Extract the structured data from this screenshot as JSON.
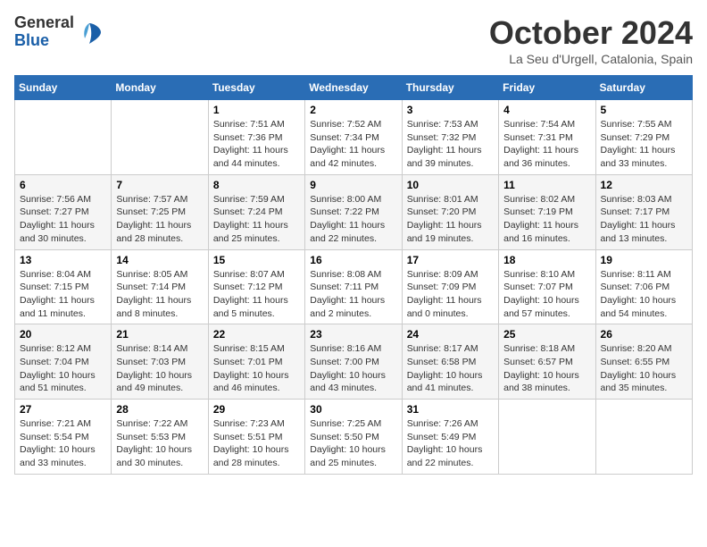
{
  "header": {
    "logo_general": "General",
    "logo_blue": "Blue",
    "month": "October 2024",
    "location": "La Seu d'Urgell, Catalonia, Spain"
  },
  "weekdays": [
    "Sunday",
    "Monday",
    "Tuesday",
    "Wednesday",
    "Thursday",
    "Friday",
    "Saturday"
  ],
  "weeks": [
    [
      {
        "day": "",
        "sunrise": "",
        "sunset": "",
        "daylight": ""
      },
      {
        "day": "",
        "sunrise": "",
        "sunset": "",
        "daylight": ""
      },
      {
        "day": "1",
        "sunrise": "Sunrise: 7:51 AM",
        "sunset": "Sunset: 7:36 PM",
        "daylight": "Daylight: 11 hours and 44 minutes."
      },
      {
        "day": "2",
        "sunrise": "Sunrise: 7:52 AM",
        "sunset": "Sunset: 7:34 PM",
        "daylight": "Daylight: 11 hours and 42 minutes."
      },
      {
        "day": "3",
        "sunrise": "Sunrise: 7:53 AM",
        "sunset": "Sunset: 7:32 PM",
        "daylight": "Daylight: 11 hours and 39 minutes."
      },
      {
        "day": "4",
        "sunrise": "Sunrise: 7:54 AM",
        "sunset": "Sunset: 7:31 PM",
        "daylight": "Daylight: 11 hours and 36 minutes."
      },
      {
        "day": "5",
        "sunrise": "Sunrise: 7:55 AM",
        "sunset": "Sunset: 7:29 PM",
        "daylight": "Daylight: 11 hours and 33 minutes."
      }
    ],
    [
      {
        "day": "6",
        "sunrise": "Sunrise: 7:56 AM",
        "sunset": "Sunset: 7:27 PM",
        "daylight": "Daylight: 11 hours and 30 minutes."
      },
      {
        "day": "7",
        "sunrise": "Sunrise: 7:57 AM",
        "sunset": "Sunset: 7:25 PM",
        "daylight": "Daylight: 11 hours and 28 minutes."
      },
      {
        "day": "8",
        "sunrise": "Sunrise: 7:59 AM",
        "sunset": "Sunset: 7:24 PM",
        "daylight": "Daylight: 11 hours and 25 minutes."
      },
      {
        "day": "9",
        "sunrise": "Sunrise: 8:00 AM",
        "sunset": "Sunset: 7:22 PM",
        "daylight": "Daylight: 11 hours and 22 minutes."
      },
      {
        "day": "10",
        "sunrise": "Sunrise: 8:01 AM",
        "sunset": "Sunset: 7:20 PM",
        "daylight": "Daylight: 11 hours and 19 minutes."
      },
      {
        "day": "11",
        "sunrise": "Sunrise: 8:02 AM",
        "sunset": "Sunset: 7:19 PM",
        "daylight": "Daylight: 11 hours and 16 minutes."
      },
      {
        "day": "12",
        "sunrise": "Sunrise: 8:03 AM",
        "sunset": "Sunset: 7:17 PM",
        "daylight": "Daylight: 11 hours and 13 minutes."
      }
    ],
    [
      {
        "day": "13",
        "sunrise": "Sunrise: 8:04 AM",
        "sunset": "Sunset: 7:15 PM",
        "daylight": "Daylight: 11 hours and 11 minutes."
      },
      {
        "day": "14",
        "sunrise": "Sunrise: 8:05 AM",
        "sunset": "Sunset: 7:14 PM",
        "daylight": "Daylight: 11 hours and 8 minutes."
      },
      {
        "day": "15",
        "sunrise": "Sunrise: 8:07 AM",
        "sunset": "Sunset: 7:12 PM",
        "daylight": "Daylight: 11 hours and 5 minutes."
      },
      {
        "day": "16",
        "sunrise": "Sunrise: 8:08 AM",
        "sunset": "Sunset: 7:11 PM",
        "daylight": "Daylight: 11 hours and 2 minutes."
      },
      {
        "day": "17",
        "sunrise": "Sunrise: 8:09 AM",
        "sunset": "Sunset: 7:09 PM",
        "daylight": "Daylight: 11 hours and 0 minutes."
      },
      {
        "day": "18",
        "sunrise": "Sunrise: 8:10 AM",
        "sunset": "Sunset: 7:07 PM",
        "daylight": "Daylight: 10 hours and 57 minutes."
      },
      {
        "day": "19",
        "sunrise": "Sunrise: 8:11 AM",
        "sunset": "Sunset: 7:06 PM",
        "daylight": "Daylight: 10 hours and 54 minutes."
      }
    ],
    [
      {
        "day": "20",
        "sunrise": "Sunrise: 8:12 AM",
        "sunset": "Sunset: 7:04 PM",
        "daylight": "Daylight: 10 hours and 51 minutes."
      },
      {
        "day": "21",
        "sunrise": "Sunrise: 8:14 AM",
        "sunset": "Sunset: 7:03 PM",
        "daylight": "Daylight: 10 hours and 49 minutes."
      },
      {
        "day": "22",
        "sunrise": "Sunrise: 8:15 AM",
        "sunset": "Sunset: 7:01 PM",
        "daylight": "Daylight: 10 hours and 46 minutes."
      },
      {
        "day": "23",
        "sunrise": "Sunrise: 8:16 AM",
        "sunset": "Sunset: 7:00 PM",
        "daylight": "Daylight: 10 hours and 43 minutes."
      },
      {
        "day": "24",
        "sunrise": "Sunrise: 8:17 AM",
        "sunset": "Sunset: 6:58 PM",
        "daylight": "Daylight: 10 hours and 41 minutes."
      },
      {
        "day": "25",
        "sunrise": "Sunrise: 8:18 AM",
        "sunset": "Sunset: 6:57 PM",
        "daylight": "Daylight: 10 hours and 38 minutes."
      },
      {
        "day": "26",
        "sunrise": "Sunrise: 8:20 AM",
        "sunset": "Sunset: 6:55 PM",
        "daylight": "Daylight: 10 hours and 35 minutes."
      }
    ],
    [
      {
        "day": "27",
        "sunrise": "Sunrise: 7:21 AM",
        "sunset": "Sunset: 5:54 PM",
        "daylight": "Daylight: 10 hours and 33 minutes."
      },
      {
        "day": "28",
        "sunrise": "Sunrise: 7:22 AM",
        "sunset": "Sunset: 5:53 PM",
        "daylight": "Daylight: 10 hours and 30 minutes."
      },
      {
        "day": "29",
        "sunrise": "Sunrise: 7:23 AM",
        "sunset": "Sunset: 5:51 PM",
        "daylight": "Daylight: 10 hours and 28 minutes."
      },
      {
        "day": "30",
        "sunrise": "Sunrise: 7:25 AM",
        "sunset": "Sunset: 5:50 PM",
        "daylight": "Daylight: 10 hours and 25 minutes."
      },
      {
        "day": "31",
        "sunrise": "Sunrise: 7:26 AM",
        "sunset": "Sunset: 5:49 PM",
        "daylight": "Daylight: 10 hours and 22 minutes."
      },
      {
        "day": "",
        "sunrise": "",
        "sunset": "",
        "daylight": ""
      },
      {
        "day": "",
        "sunrise": "",
        "sunset": "",
        "daylight": ""
      }
    ]
  ]
}
